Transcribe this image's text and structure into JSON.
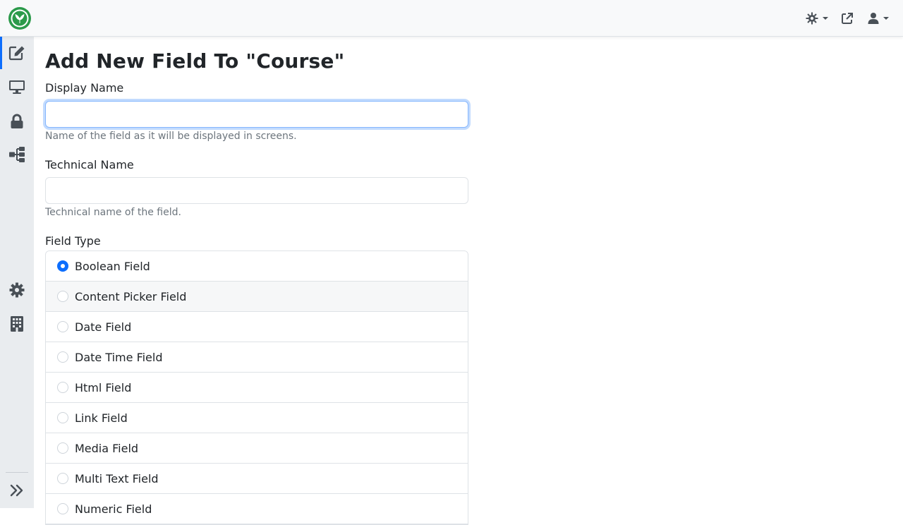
{
  "header": {
    "logo_icon": "orchard-leaf-logo",
    "theme_icon": "sun-gear-icon",
    "external_icon": "external-link-icon",
    "user_icon": "user-icon"
  },
  "sidebar": {
    "items": [
      {
        "name": "content",
        "icon": "edit-icon",
        "active": true
      },
      {
        "name": "design",
        "icon": "monitor-icon",
        "active": false
      },
      {
        "name": "security",
        "icon": "lock-icon",
        "active": false
      },
      {
        "name": "workflows",
        "icon": "sitemap-icon",
        "active": false
      },
      {
        "name": "configuration",
        "icon": "gear-icon",
        "active": false
      },
      {
        "name": "tenants",
        "icon": "building-icon",
        "active": false
      }
    ],
    "collapse_icon": "double-chevron-right-icon"
  },
  "page": {
    "title": "Add New Field To \"Course\""
  },
  "form": {
    "display_name": {
      "label": "Display Name",
      "value": "",
      "hint": "Name of the field as it will be displayed in screens."
    },
    "technical_name": {
      "label": "Technical Name",
      "value": "",
      "hint": "Technical name of the field."
    },
    "field_type": {
      "label": "Field Type",
      "options": [
        {
          "label": "Boolean Field",
          "checked": true
        },
        {
          "label": "Content Picker Field",
          "checked": false
        },
        {
          "label": "Date Field",
          "checked": false
        },
        {
          "label": "Date Time Field",
          "checked": false
        },
        {
          "label": "Html Field",
          "checked": false
        },
        {
          "label": "Link Field",
          "checked": false
        },
        {
          "label": "Media Field",
          "checked": false
        },
        {
          "label": "Multi Text Field",
          "checked": false
        },
        {
          "label": "Numeric Field",
          "checked": false
        }
      ]
    }
  },
  "colors": {
    "accent": "#0d6efd",
    "brand_green": "#2b9a4a",
    "sidebar_bg": "#e9ecef"
  }
}
